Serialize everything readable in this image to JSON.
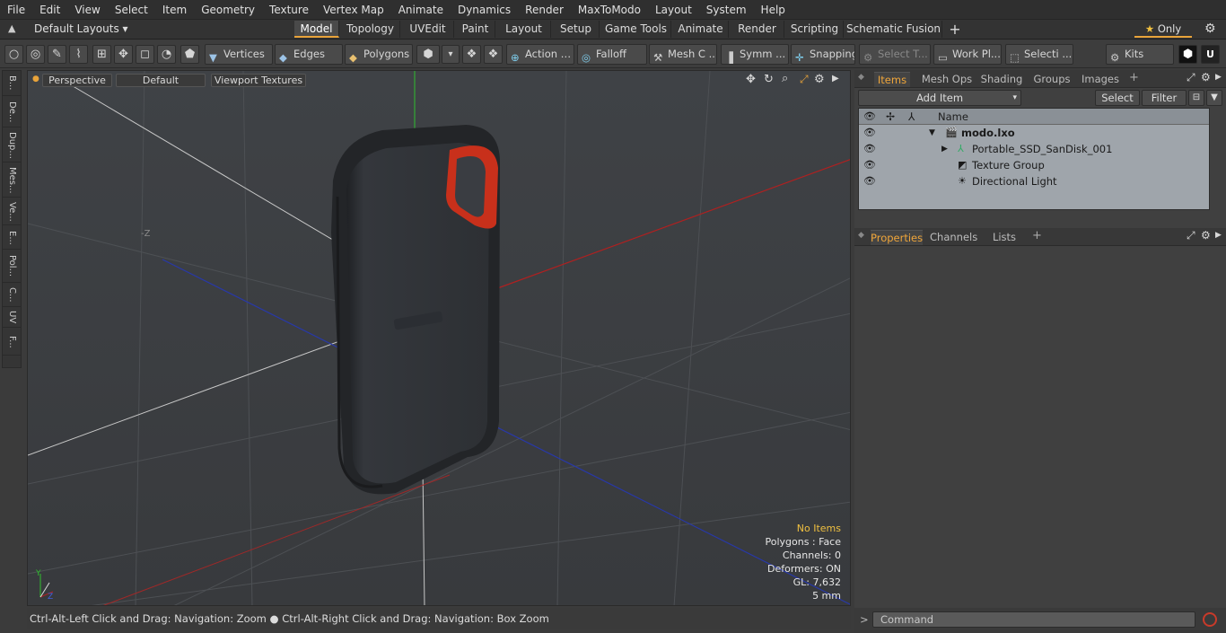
{
  "menu": [
    "File",
    "Edit",
    "View",
    "Select",
    "Item",
    "Geometry",
    "Texture",
    "Vertex Map",
    "Animate",
    "Dynamics",
    "Render",
    "MaxToModo",
    "Layout",
    "System",
    "Help"
  ],
  "layoutbar": {
    "layouts_label": "Default Layouts",
    "tabs": [
      "Model",
      "Topology",
      "UVEdit",
      "Paint",
      "Layout",
      "Setup",
      "Game Tools",
      "Animate",
      "Render",
      "Scripting",
      "Schematic Fusion"
    ],
    "add_label": "+",
    "only_label": "Only"
  },
  "toolbar": {
    "vertices": "Vertices",
    "edges": "Edges",
    "polygons": "Polygons",
    "action": "Action",
    "falloff": "Falloff",
    "mesh": "Mesh C ...",
    "symm": "Symm ...",
    "snapping": "Snapping",
    "select_t": "Select T...",
    "workpl": "Work Pl...",
    "selecti": "Selecti ...",
    "kits": "Kits"
  },
  "lefttabs": [
    "B...",
    "De...",
    "Dup...",
    "Mes...",
    "Ve...",
    "E...",
    "Pol...",
    "C...",
    "UV",
    "F..."
  ],
  "viewport": {
    "perspective": "Perspective",
    "default": "Default",
    "textures": "Viewport Textures",
    "axis_z": "-Z",
    "info": {
      "no_items": "No Items",
      "polygons": "Polygons : Face",
      "channels": "Channels: 0",
      "deformers": "Deformers: ON",
      "gl": "GL: 7,632",
      "scale": "5 mm"
    }
  },
  "status": "Ctrl-Alt-Left Click and Drag: Navigation: Zoom ● Ctrl-Alt-Right Click and Drag: Navigation: Box Zoom",
  "items_panel": {
    "tabs": [
      "Items",
      "Mesh Ops",
      "Shading",
      "Groups",
      "Images"
    ],
    "add_item": "Add Item",
    "select": "Select",
    "filter": "Filter",
    "name_header": "Name",
    "rows": [
      "modo.lxo",
      "Portable_SSD_SanDisk_001",
      "Texture Group",
      "Directional Light"
    ]
  },
  "props_panel": {
    "tabs": [
      "Properties",
      "Channels",
      "Lists"
    ]
  },
  "command": {
    "placeholder": "Command"
  },
  "colors": {
    "accent": "#f0a63a",
    "device_body": "#2e3034",
    "device_accent": "#c8301b"
  }
}
